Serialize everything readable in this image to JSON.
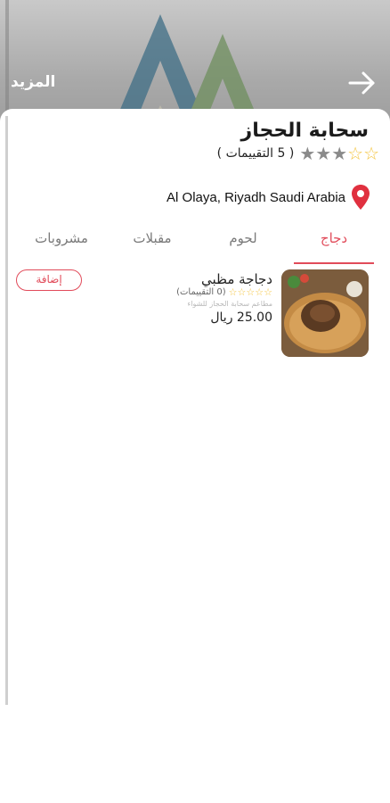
{
  "header": {
    "more_label": "المزيد"
  },
  "restaurant": {
    "name": "سحابة الحجاز",
    "rating_stars": 3,
    "rating_count_label": "( 5 التقييمات )",
    "address": "Al Olaya, Riyadh Saudi Arabia"
  },
  "tabs": [
    {
      "label": "دجاج",
      "active": true
    },
    {
      "label": "لحوم",
      "active": false
    },
    {
      "label": "مقبلات",
      "active": false
    },
    {
      "label": "مشروبات",
      "active": false
    }
  ],
  "items": [
    {
      "title": "دجاجة مظبي",
      "rating_stars": 0,
      "rating_count_label": "(0 التقييمات)",
      "description": "مطاعم سحابة الحجاز للشواء",
      "price": "25.00 ريال",
      "add_label": "إضافة"
    }
  ],
  "colors": {
    "accent": "#e14b5a",
    "star": "#f4c542",
    "star_gray": "#8a8a8a"
  },
  "icons": {
    "back": "arrow-right-icon",
    "location": "map-pin-icon",
    "star": "star-icon"
  }
}
